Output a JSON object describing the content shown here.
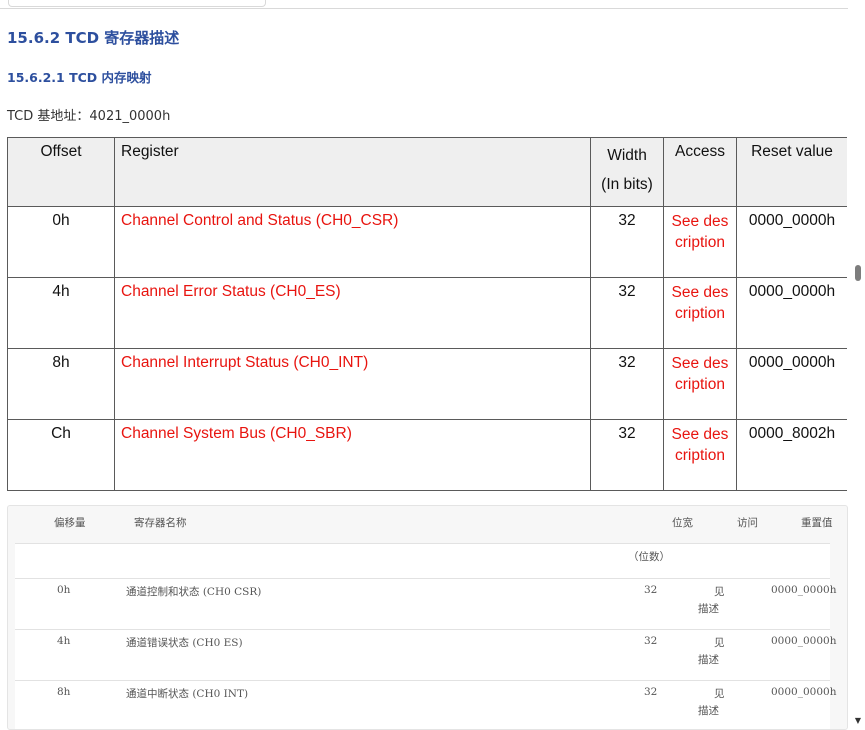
{
  "section": {
    "heading": "15.6.2 TCD 寄存器描述",
    "subheading": "15.6.2.1 TCD 内存映射",
    "base_address": "TCD 基地址：4021_0000h"
  },
  "register_table": {
    "headers": {
      "offset": "Offset",
      "register": "Register",
      "width_line1": "Width",
      "width_line2": "(In bits)",
      "access": "Access",
      "reset": "Reset value"
    },
    "rows": [
      {
        "offset": "0h",
        "register": "Channel Control and Status (CH0_CSR)",
        "width": "32",
        "access": "See description",
        "reset": "0000_0000h"
      },
      {
        "offset": "4h",
        "register": "Channel Error Status (CH0_ES)",
        "width": "32",
        "access": "See description",
        "reset": "0000_0000h"
      },
      {
        "offset": "8h",
        "register": "Channel Interrupt Status (CH0_INT)",
        "width": "32",
        "access": "See description",
        "reset": "0000_0000h"
      },
      {
        "offset": "Ch",
        "register": "Channel System Bus (CH0_SBR)",
        "width": "32",
        "access": "See description",
        "reset": "0000_8002h"
      }
    ]
  },
  "translated_table": {
    "headers": {
      "offset": "偏移量",
      "register": "寄存器名称",
      "width": "位宽",
      "access": "访问",
      "reset": "重置值",
      "width_unit": "（位数）"
    },
    "rows": [
      {
        "offset": "0h",
        "register": "通道控制和状态 (CH0 CSR)",
        "width": "32",
        "access_line1": "见",
        "access_line2": "描述",
        "reset": "0000_0000h"
      },
      {
        "offset": "4h",
        "register": "通道错误状态 (CH0 ES)",
        "width": "32",
        "access_line1": "见",
        "access_line2": "描述",
        "reset": "0000_0000h"
      },
      {
        "offset": "8h",
        "register": "通道中断状态 (CH0 INT)",
        "width": "32",
        "access_line1": "见",
        "access_line2": "描述",
        "reset": "0000_0000h"
      }
    ]
  },
  "scrollbar": {
    "down_arrow": "▼"
  }
}
